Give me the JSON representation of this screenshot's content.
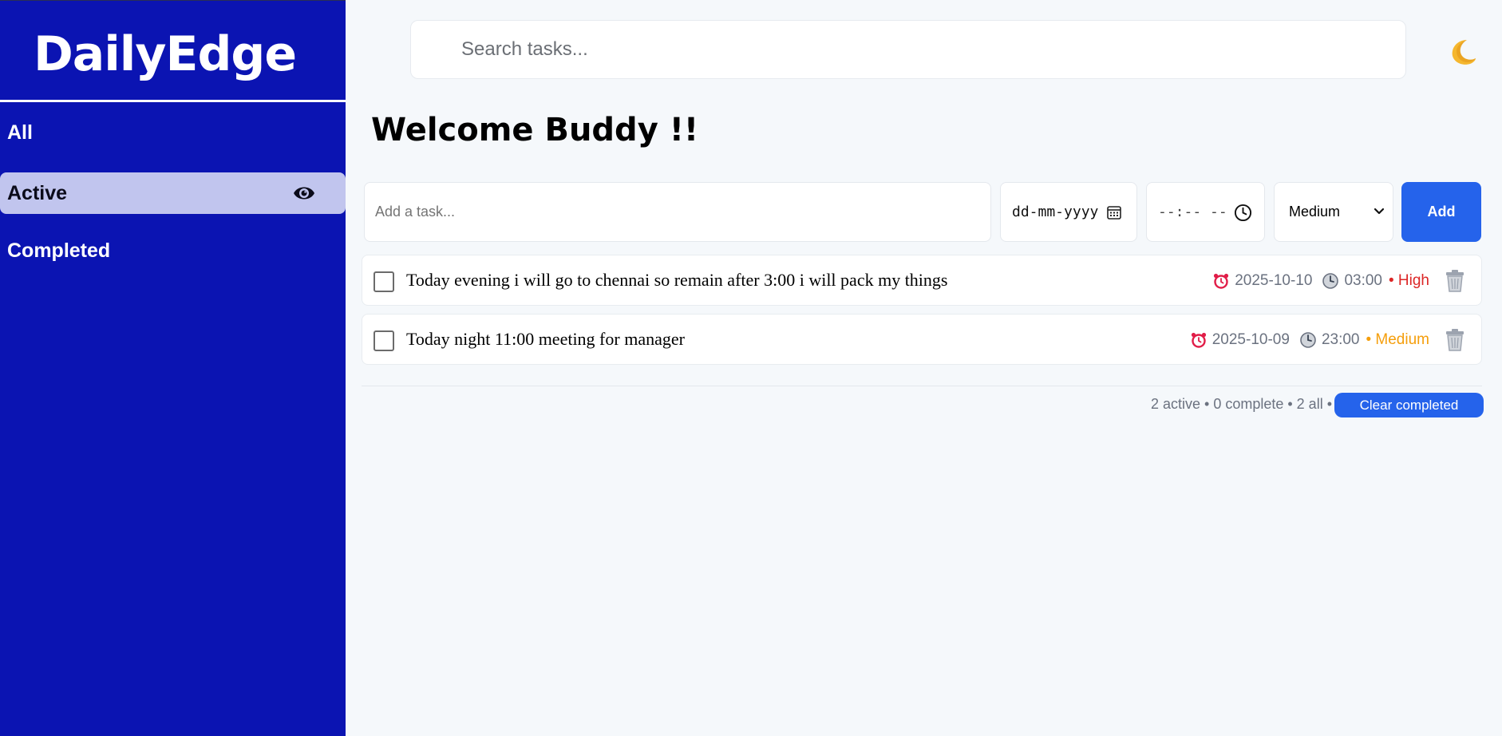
{
  "app": {
    "brand": "DailyEdge"
  },
  "sidebar": {
    "items": [
      {
        "label": "All",
        "active": false
      },
      {
        "label": "Active",
        "active": true,
        "icon": "eye-icon"
      },
      {
        "label": "Completed",
        "active": false
      }
    ]
  },
  "search": {
    "placeholder": "Search tasks...",
    "value": ""
  },
  "theme_toggle": {
    "icon": "moon-icon"
  },
  "main": {
    "welcome": "Welcome Buddy !!"
  },
  "add_form": {
    "task_placeholder": "Add a task...",
    "date_placeholder": "dd-mm-yyyy",
    "time_placeholder": "--:-- --",
    "priority_selected": "Medium",
    "add_label": "Add"
  },
  "tasks": [
    {
      "text": "Today evening i will go to chennai so remain after 3:00 i will pack my things",
      "date": "2025-10-10",
      "time": "03:00",
      "priority": "• High",
      "priority_color": "#dc2626",
      "completed": false
    },
    {
      "text": "Today night 11:00 meeting for manager",
      "date": "2025-10-09",
      "time": "23:00",
      "priority": "• Medium",
      "priority_color": "#f59e0b",
      "completed": false
    }
  ],
  "footer": {
    "stats": "2 active • 0 complete • 2 all •",
    "clear_label": "Clear completed"
  },
  "colors": {
    "sidebar": "#0b14b2",
    "accent": "#2563eb",
    "active_nav": "#c1c5ee",
    "background": "#f5f8fb"
  }
}
